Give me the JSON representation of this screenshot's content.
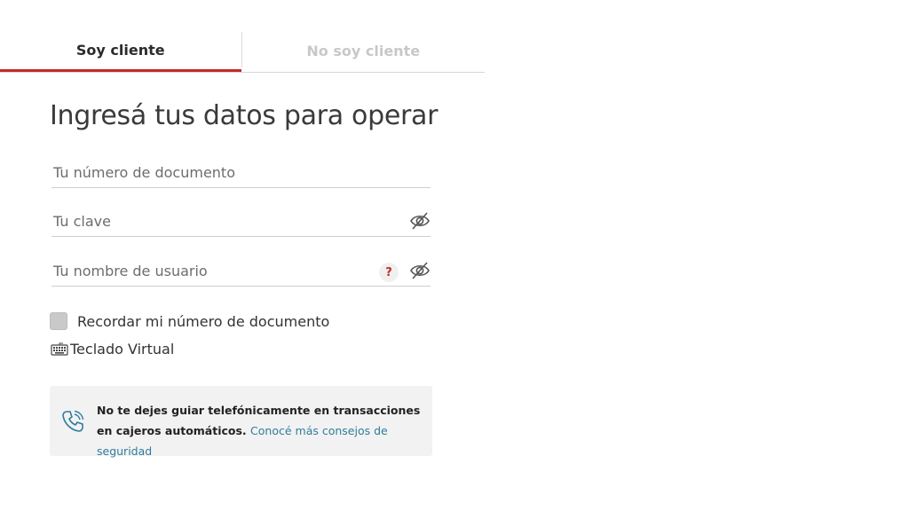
{
  "tabs": {
    "client": "Soy cliente",
    "non_client": "No soy cliente"
  },
  "form": {
    "heading": "Ingresá tus datos para operar",
    "document_placeholder": "Tu número de documento",
    "password_placeholder": "Tu clave",
    "username_placeholder": "Tu nombre de usuario",
    "help_symbol": "?",
    "remember_label": "Recordar mi número de documento",
    "virtual_keyboard_label": "Teclado Virtual"
  },
  "notice": {
    "text": "No te dejes guiar telefónicamente en transacciones en cajeros automáticos.",
    "link": "Conocé más consejos de seguridad"
  },
  "colors": {
    "accent": "#c42a2a",
    "link": "#2f7d9c",
    "notice_bg": "#f2f2f2"
  },
  "icons": {
    "password_toggle": "eye-slash-icon",
    "username_toggle": "eye-slash-icon",
    "help": "question-icon",
    "keyboard": "keyboard-icon",
    "notice": "phone-icon"
  }
}
